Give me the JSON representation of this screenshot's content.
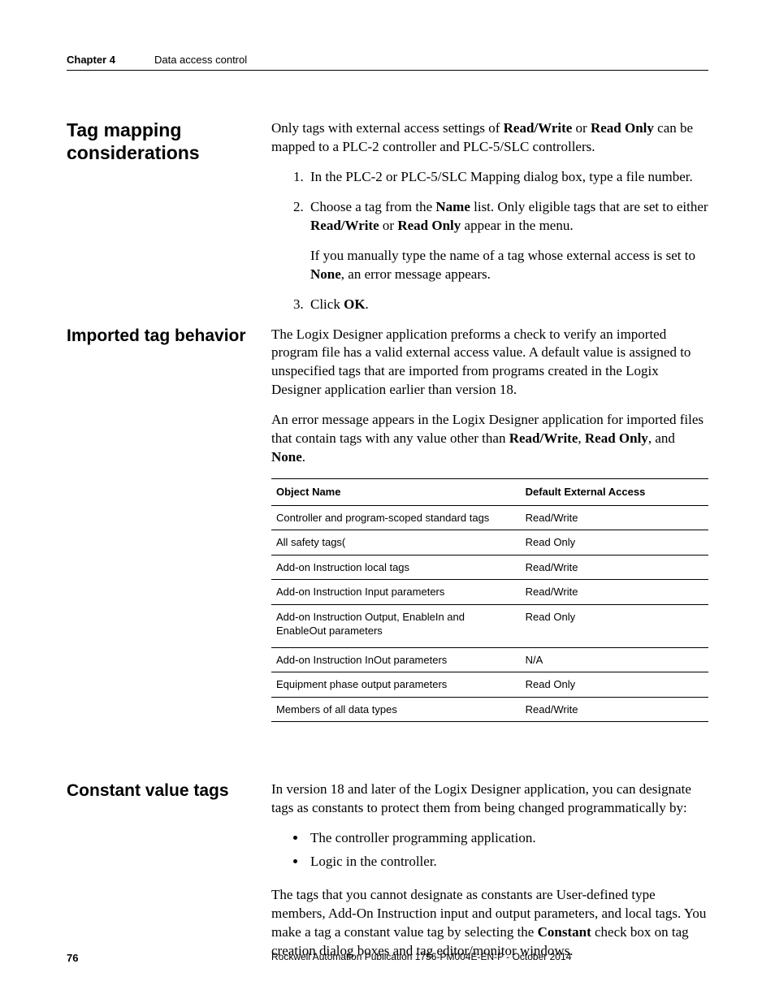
{
  "running_head": {
    "chapter": "Chapter 4",
    "title": "Data access control"
  },
  "sections": {
    "tag_mapping": {
      "heading": "Tag mapping considerations",
      "intro_pre": "Only tags with external access settings of ",
      "intro_b1": "Read/Write",
      "intro_mid": " or ",
      "intro_b2": "Read Only",
      "intro_post": " can be mapped to a PLC-2 controller and PLC-5/SLC controllers.",
      "step1": "In the PLC-2 or PLC-5/SLC Mapping dialog box, type a file number.",
      "step2_pre": "Choose a tag from the ",
      "step2_b1": "Name",
      "step2_mid": " list. Only eligible tags that are set to either ",
      "step2_b2": "Read/Write",
      "step2_mid2": " or ",
      "step2_b3": "Read Only",
      "step2_post": " appear in the menu.",
      "step2_note_pre": "If you manually type the name of a tag whose external access is set to ",
      "step2_note_b": "None",
      "step2_note_post": ", an error message appears.",
      "step3_pre": "Click ",
      "step3_b": "OK",
      "step3_post": "."
    },
    "imported": {
      "heading": "Imported tag behavior",
      "p1": "The Logix Designer application preforms a check to verify an imported program file has a valid external access value. A default value is assigned to unspecified tags that are imported from programs created in the Logix Designer application earlier than version 18.",
      "p2_pre": "An error message appears in the Logix Designer application for imported files that contain tags with any value other than ",
      "p2_b1": "Read/Write",
      "p2_c1": ", ",
      "p2_b2": "Read Only",
      "p2_c2": ", and ",
      "p2_b3": "None",
      "p2_post": ".",
      "table": {
        "headers": [
          "Object Name",
          "Default External Access"
        ],
        "rows": [
          [
            "Controller and program-scoped standard tags",
            "Read/Write"
          ],
          [
            "All safety tags(",
            "Read Only"
          ],
          [
            "Add-on Instruction local tags",
            "Read/Write"
          ],
          [
            "Add-on Instruction Input parameters",
            "Read/Write"
          ],
          [
            "Add-on Instruction Output, EnableIn and EnableOut parameters",
            "Read Only"
          ],
          [
            "Add-on Instruction InOut parameters",
            "N/A"
          ],
          [
            "Equipment phase output parameters",
            "Read Only"
          ],
          [
            "Members of all data types",
            "Read/Write"
          ]
        ]
      }
    },
    "constant": {
      "heading": "Constant value tags",
      "p1": "In version 18 and later of the Logix Designer application, you can designate tags as constants to protect them from being changed programmatically by:",
      "bullets": [
        "The controller programming application.",
        "Logic in the controller."
      ],
      "p2_pre": "The tags that you cannot designate as constants are User-defined type members, Add-On Instruction input and output parameters, and local tags. You make a tag a constant value tag by selecting the ",
      "p2_b": "Constant",
      "p2_post": " check box on tag creation dialog boxes and tag editor/monitor windows."
    }
  },
  "footer": {
    "page": "76",
    "publication": "Rockwell Automation Publication 1756-PM004E-EN-P - October 2014"
  }
}
